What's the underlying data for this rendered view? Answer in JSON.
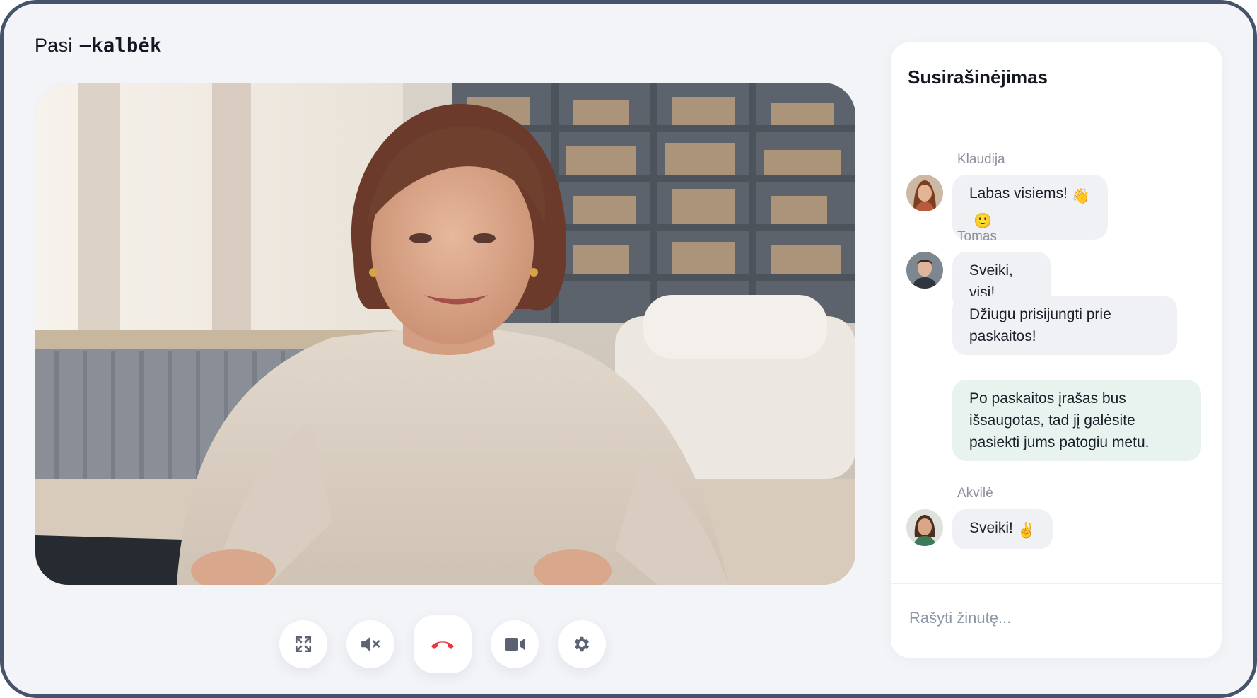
{
  "app": {
    "logo_light": "Pasi",
    "logo_bold": "–kalbėk"
  },
  "controls": [
    {
      "name": "fullscreen",
      "icon": "expand-icon"
    },
    {
      "name": "mute",
      "icon": "speaker-muted-icon"
    },
    {
      "name": "hang-up",
      "icon": "phone-hangup-icon",
      "color": "#e5373d"
    },
    {
      "name": "camera",
      "icon": "video-camera-icon"
    },
    {
      "name": "settings",
      "icon": "gear-icon"
    }
  ],
  "chat": {
    "title": "Susirašinėjimas",
    "messages": [
      {
        "sender": "Klaudija",
        "text": "Labas visiems!",
        "emojis": [
          "👋",
          "🙂"
        ]
      },
      {
        "sender": "Tomas",
        "text": "Sveiki, visi!"
      },
      {
        "sender": "Tomas",
        "text": "Džiugu prisijungti prie paskaitos!"
      },
      {
        "sender": "",
        "text": "Po paskaitos įrašas bus išsaugotas, tad jį galėsite pasiekti jums patogiu metu."
      },
      {
        "sender": "Akvilė",
        "text": "Sveiki!",
        "emojis": [
          "✌️"
        ]
      }
    ],
    "composer_placeholder": "Rašyti žinutę..."
  },
  "colors": {
    "background": "#f2f4f8",
    "frame_border": "#46536b",
    "bubble_other": "#eff1f5",
    "bubble_mine": "#e8f2ee",
    "hangup_red": "#e5373d"
  }
}
